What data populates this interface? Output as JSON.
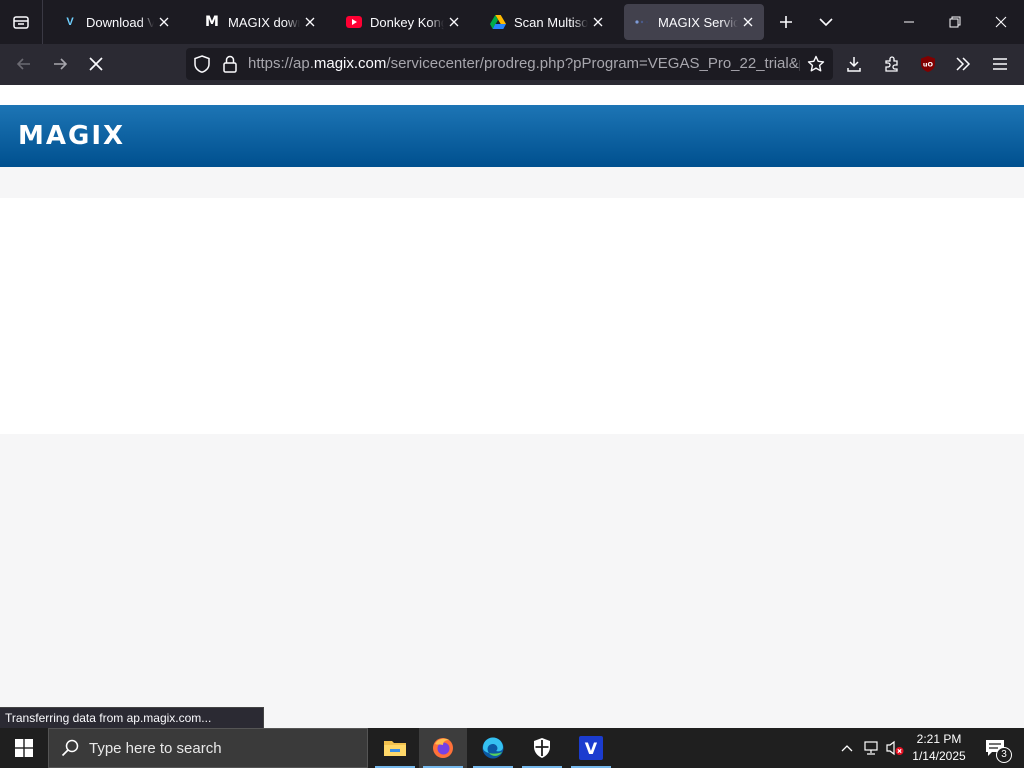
{
  "tabs": [
    {
      "title": "Download VEGAS Pro",
      "favicon": "vegas-v-icon"
    },
    {
      "title": "MAGIX download",
      "favicon": "magix-m-icon"
    },
    {
      "title": "Donkey Kong Country",
      "favicon": "youtube-icon"
    },
    {
      "title": "Scan Multisource",
      "favicon": "google-drive-icon"
    },
    {
      "title": "MAGIX Service Center",
      "favicon": "loading-dots-icon",
      "active": true
    }
  ],
  "urlbar": {
    "scheme_prefix": "https://ap.",
    "host": "magix.com",
    "path": "/servicecenter/prodreg.php?pProgram=VEGAS_Pro_22_trial&pChargeType=..."
  },
  "page": {
    "logo": "MAGIX",
    "header_colors": {
      "top": "#1d75b5",
      "bottom": "#00508f"
    }
  },
  "status_text": "Transferring data from ap.magix.com...",
  "taskbar": {
    "search_placeholder": "Type here to search",
    "time": "2:21 PM",
    "date": "1/14/2025",
    "notification_count": "3"
  }
}
